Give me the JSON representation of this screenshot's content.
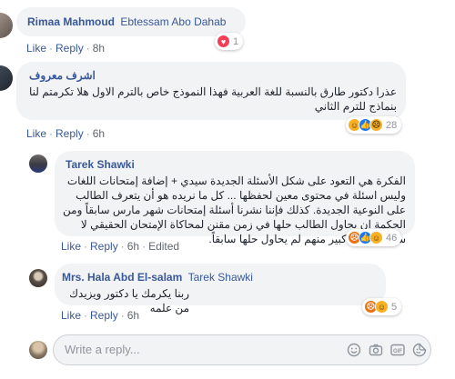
{
  "comments": [
    {
      "author": "Rimaa Mahmoud",
      "tag": "Ebtessam Abo Dahab",
      "text": "",
      "like": "Like",
      "reply": "Reply",
      "time": "8h",
      "reactions": [
        "love"
      ],
      "reaction_count": "1"
    },
    {
      "author": "اشرف معروف",
      "text": "عذرا دكتور طارق بالنسبة للغة العربية فهذا النموذج خاص بالترم الاول هلا تكرمتم لنا بنماذج للترم الثاني",
      "like": "Like",
      "reply": "Reply",
      "time": "6h",
      "reactions": [
        "haha",
        "like",
        "sad"
      ],
      "reaction_count": "28"
    },
    {
      "author": "Tarek Shawki",
      "text": "الفكرة هي التعود على شكل الأسئلة الجديدة سيدي + إضافة إمتحانات اللغات وليس اسئلة في محتوى معين لحفظها ... كل ما نريده هو أن يتعرف الطالب على النوعية الجديدة. كذلك فإننا نشرنا أسئلة إمتحانات شهر مارس سابقاً ومن الحكمة ان يحاول الطالب حلها في زمن مقنن لمحاكاة الإمتحان الحقيقي لا سيما أن عدد كبير منهم لم يحاول حلها سابقاً.",
      "like": "Like",
      "reply": "Reply",
      "time": "6h",
      "edited": "Edited",
      "reactions": [
        "angry",
        "like",
        "haha"
      ],
      "reaction_count": "46"
    },
    {
      "author": "Mrs. Hala Abd El-salam",
      "tag": "Tarek Shawki",
      "text": "ربنا يكرمك يا دكتور ويزيدك من علمه",
      "like": "Like",
      "reply": "Reply",
      "time": "6h",
      "reactions": [
        "angry",
        "haha"
      ],
      "reaction_count": "5"
    }
  ],
  "reply_box": {
    "placeholder": "Write a reply...",
    "tools": [
      "emoji-icon",
      "camera-icon",
      "gif-icon",
      "sticker-icon"
    ]
  },
  "colors": {
    "link": "#385898",
    "bubble": "#f2f3f5",
    "meta": "#616770"
  }
}
